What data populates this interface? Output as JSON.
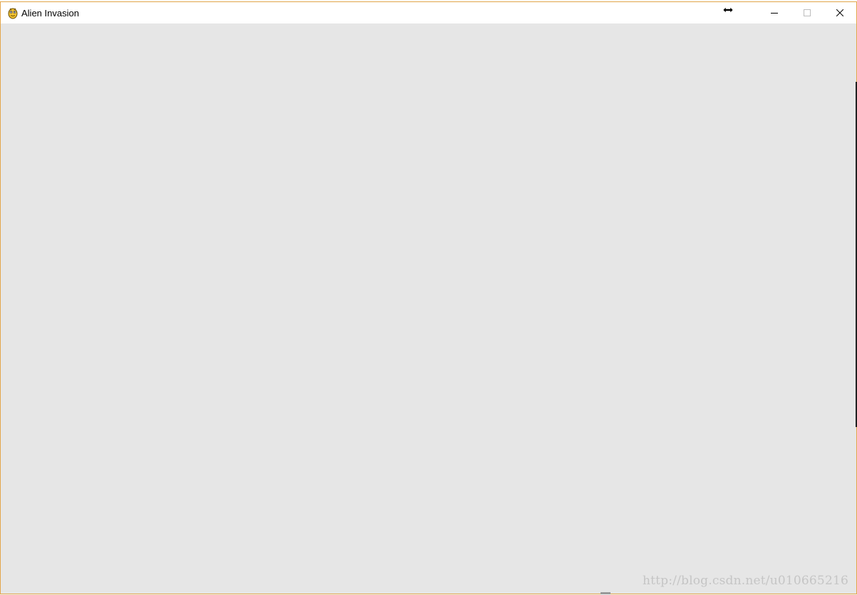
{
  "window": {
    "title": "Alien Invasion",
    "icon": "pygame-snake-icon",
    "background_color": "#e6e6e6",
    "border_color": "#e3a64a",
    "controls": {
      "minimize": "minimize-icon",
      "maximize": "maximize-icon",
      "close": "close-icon"
    }
  },
  "cursor": {
    "icon": "horizontal-resize-cursor-icon"
  },
  "watermark": {
    "text": "http://blog.csdn.net/u010665216"
  }
}
